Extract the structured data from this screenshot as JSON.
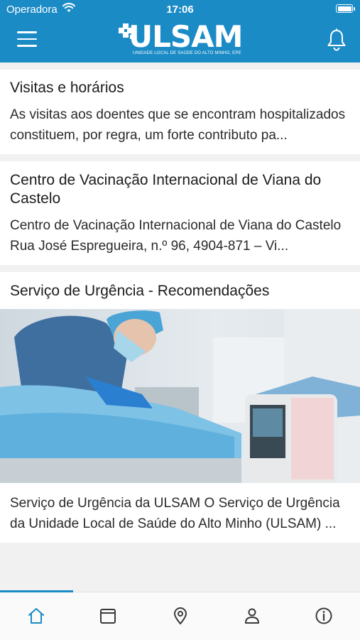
{
  "status_bar": {
    "carrier": "Operadora",
    "time": "17:06"
  },
  "header": {
    "logo_text": "ULSAM",
    "logo_tagline": "UNIDADE LOCAL DE SAÚDE DO ALTO MINHO, EPE",
    "accent_color": "#1b8bc6"
  },
  "articles": [
    {
      "title": "Visitas e horários",
      "excerpt": "As visitas aos doentes que se encontram hospitalizados constituem, por regra, um forte contributo pa..."
    },
    {
      "title": "Centro de Vacinação Internacional de Viana do Castelo",
      "excerpt": "Centro de Vacinação Internacional de Viana do Castelo Rua José Espregueira, n.º 96, 4904-871 – Vi..."
    },
    {
      "title": "Serviço de Urgência - Recomendações",
      "excerpt": "Serviço de Urgência da ULSAM O Serviço de Urgência da Unidade Local de Saúde do Alto Minho (ULSAM) ..."
    }
  ],
  "tab_bar": {
    "tabs": [
      "home-icon",
      "calendar-icon",
      "location-pin-icon",
      "person-icon",
      "info-icon"
    ],
    "active_tab": "home-icon"
  }
}
